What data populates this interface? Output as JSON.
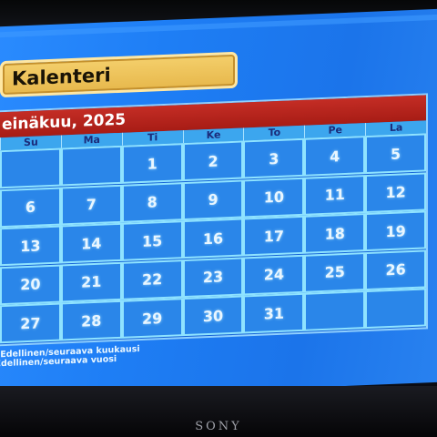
{
  "app": {
    "title": "Kalenteri",
    "month_label": "einäkuu, 2025"
  },
  "weekdays": [
    "Su",
    "Ma",
    "Ti",
    "Ke",
    "To",
    "Pe",
    "La"
  ],
  "weeks": [
    [
      "",
      "",
      "1",
      "2",
      "3",
      "4",
      "5"
    ],
    [
      "6",
      "7",
      "8",
      "9",
      "10",
      "11",
      "12"
    ],
    [
      "13",
      "14",
      "15",
      "16",
      "17",
      "18",
      "19"
    ],
    [
      "20",
      "21",
      "22",
      "23",
      "24",
      "25",
      "26"
    ],
    [
      "27",
      "28",
      "29",
      "30",
      "31",
      "",
      ""
    ]
  ],
  "hints": [
    "Pa: Edellinen/seuraava kuukausi",
    "/-: Edellinen/seuraava vuosi"
  ],
  "brand": "SONY",
  "colors": {
    "screen_bg": "#1e7ef5",
    "title_bar": "#e7b84c",
    "month_bar": "#b32219",
    "day_cell": "#2a86e9",
    "cell_border": "#8fe3ff"
  }
}
